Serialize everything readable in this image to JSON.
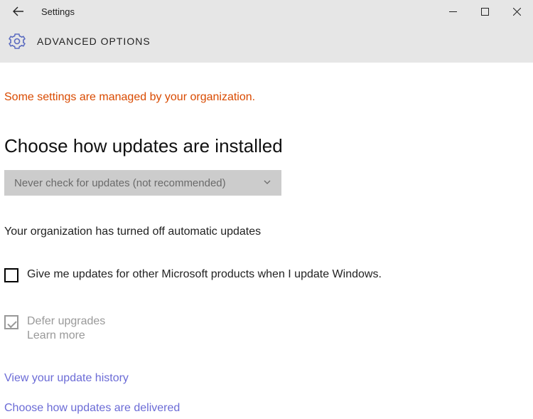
{
  "titlebar": {
    "title": "Settings"
  },
  "header": {
    "page_title": "ADVANCED OPTIONS"
  },
  "notice": "Some settings are managed by your organization.",
  "section": {
    "heading": "Choose how updates are installed",
    "dropdown_value": "Never check for updates (not recommended)",
    "org_note": "Your organization has turned off automatic updates"
  },
  "options": {
    "ms_products_label": "Give me updates for other Microsoft products when I update Windows.",
    "defer_label": "Defer upgrades",
    "learn_more": "Learn more"
  },
  "links": {
    "history": "View your update history",
    "delivery": "Choose how updates are delivered"
  }
}
